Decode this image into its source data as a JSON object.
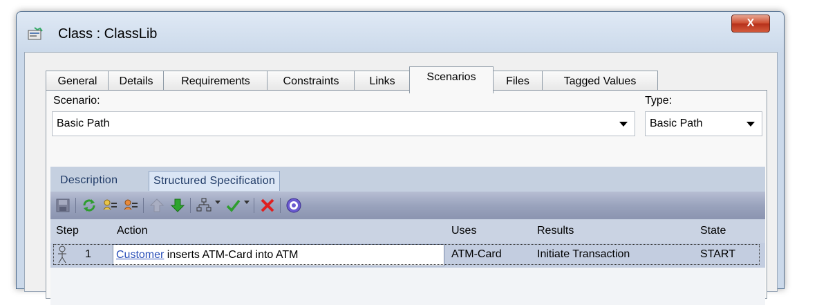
{
  "window": {
    "title": "Class : ClassLib",
    "close_label": "X"
  },
  "tabs": [
    {
      "label": "General"
    },
    {
      "label": "Details"
    },
    {
      "label": "Requirements"
    },
    {
      "label": "Constraints"
    },
    {
      "label": "Links"
    },
    {
      "label": "Scenarios"
    },
    {
      "label": "Files"
    },
    {
      "label": "Tagged Values"
    }
  ],
  "scenario": {
    "label": "Scenario:",
    "value": "Basic Path"
  },
  "type": {
    "label": "Type:",
    "value": "Basic Path"
  },
  "subtabs": [
    {
      "label": "Description"
    },
    {
      "label": "Structured Specification"
    }
  ],
  "toolbar": {
    "icons": [
      "save-icon",
      "refresh-icon",
      "add-step-icon",
      "insert-step-icon",
      "move-up-icon",
      "move-down-icon",
      "generate-diagram-icon",
      "validate-icon",
      "delete-icon",
      "help-icon"
    ]
  },
  "grid": {
    "headers": {
      "step": "Step",
      "action": "Action",
      "uses": "Uses",
      "results": "Results",
      "state": "State"
    },
    "rows": [
      {
        "step": "1",
        "action_link": "Customer",
        "action_rest": " inserts ATM-Card into ATM",
        "uses": "ATM-Card",
        "results": "Initiate Transaction",
        "state": "START"
      }
    ]
  },
  "colors": {
    "accent": "#2a4fb8",
    "toolbar": "#9aa3bd",
    "close": "#cc4a2d"
  }
}
